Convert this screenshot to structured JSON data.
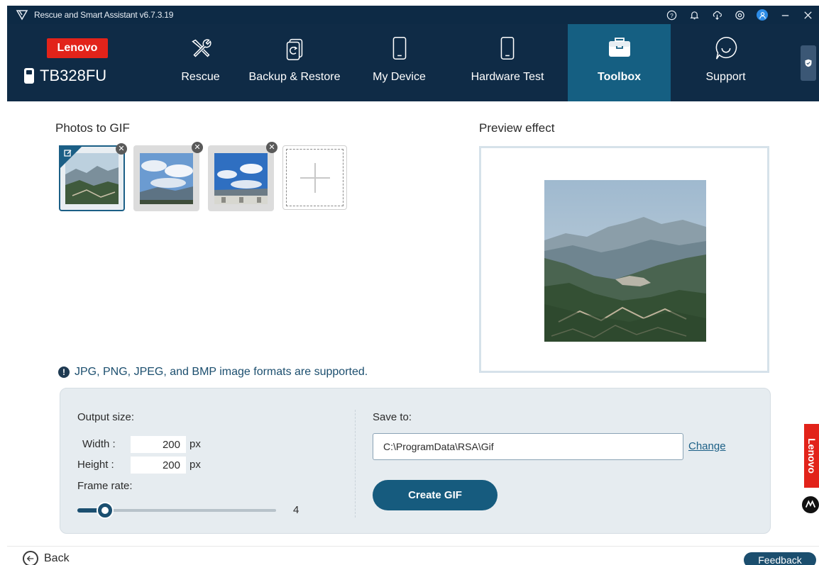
{
  "window": {
    "title": "Rescue and Smart Assistant v6.7.3.19",
    "controls": [
      "help-icon",
      "bell-icon",
      "cloud-download-icon",
      "settings-icon",
      "user-icon",
      "minimize-icon",
      "close-icon"
    ]
  },
  "brand": {
    "logo_text": "Lenovo",
    "device_name": "TB328FU"
  },
  "nav": {
    "items": [
      {
        "label": "Rescue",
        "icon": "tools-icon",
        "active": false
      },
      {
        "label": "Backup & Restore",
        "icon": "backup-restore-icon",
        "active": false
      },
      {
        "label": "My Device",
        "icon": "tablet-icon",
        "active": false
      },
      {
        "label": "Hardware Test",
        "icon": "tablet-icon",
        "active": false
      },
      {
        "label": "Toolbox",
        "icon": "toolbox-icon",
        "active": true
      },
      {
        "label": "Support",
        "icon": "chat-icon",
        "active": false
      }
    ]
  },
  "photos": {
    "title": "Photos to GIF",
    "thumbnail_count": 3,
    "selected_index": 0
  },
  "preview": {
    "title": "Preview effect"
  },
  "info": {
    "text": "JPG, PNG, JPEG, and BMP image formats are supported."
  },
  "output": {
    "size_label": "Output size:",
    "width_label": "Width :",
    "width_value": "200",
    "height_label": "Height :",
    "height_value": "200",
    "unit": "px",
    "frame_rate_label": "Frame rate:",
    "frame_rate_value": "4",
    "frame_rate_fraction": 0.14
  },
  "save": {
    "label": "Save to:",
    "path": "C:\\ProgramData\\RSA\\Gif",
    "change_label": "Change",
    "create_button": "Create GIF"
  },
  "side": {
    "lenovo_text": "Lenovo"
  },
  "footer": {
    "back_label": "Back",
    "feedback_label": "Feedback"
  },
  "colors": {
    "header_bg": "#0f2b46",
    "active_tab": "#155f82",
    "accent": "#165b7e",
    "brand_red": "#e2231a"
  }
}
